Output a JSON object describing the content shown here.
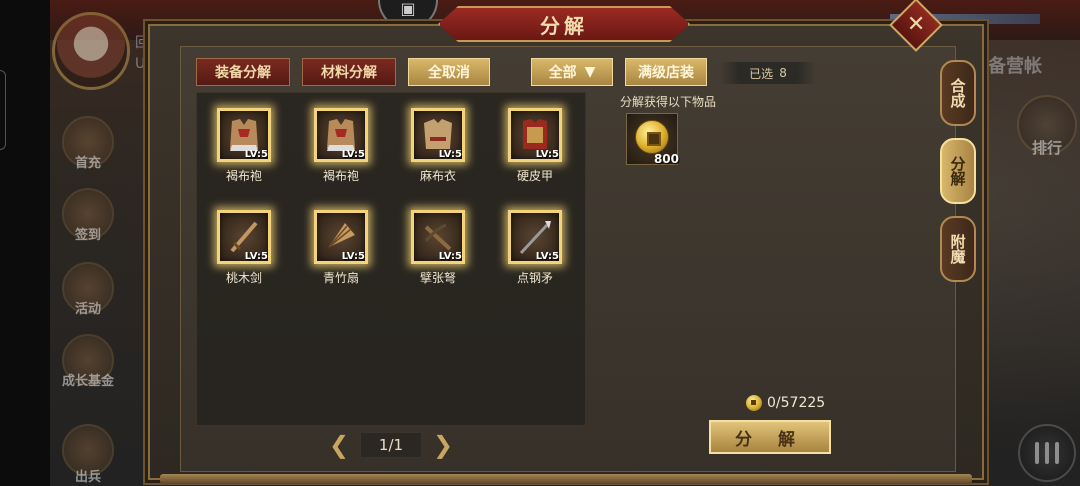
{
  "title": "分解",
  "hud": {
    "player_name": "回游",
    "uid_label": "UID",
    "side_buttons": [
      "首充",
      "签到",
      "活动",
      "成长基金",
      "出兵"
    ],
    "location": "刘备营帐",
    "rank_label": "排行"
  },
  "tabs": {
    "equip_decompose": "装备分解",
    "material_decompose": "材料分解",
    "cancel_all": "全取消",
    "filter": "全部",
    "filter_arrow": "▼",
    "full_level_equip": "满级店装",
    "selected_label": "已选",
    "selected_count": "8"
  },
  "items": [
    {
      "name": "褐布袍",
      "level": "LV:5",
      "icon": "robe-icon"
    },
    {
      "name": "褐布袍",
      "level": "LV:5",
      "icon": "robe-icon"
    },
    {
      "name": "麻布衣",
      "level": "LV:5",
      "icon": "cloth-armor-icon"
    },
    {
      "name": "硬皮甲",
      "level": "LV:5",
      "icon": "leather-armor-icon"
    },
    {
      "name": "桃木剑",
      "level": "LV:5",
      "icon": "sword-icon"
    },
    {
      "name": "青竹扇",
      "level": "LV:5",
      "icon": "fan-icon"
    },
    {
      "name": "擘张弩",
      "level": "LV:5",
      "icon": "crossbow-icon"
    },
    {
      "name": "点钢矛",
      "level": "LV:5",
      "icon": "spear-icon"
    }
  ],
  "gain": {
    "label": "分解获得以下物品",
    "item_icon": "copper-coin-icon",
    "count": "800"
  },
  "coin_total": "0/57225",
  "decompose_button": "分 解",
  "pager": {
    "prev": "❮",
    "page": "1/1",
    "next": "❯"
  },
  "side_tabs": [
    {
      "label": "合成",
      "active": false
    },
    {
      "label": "分解",
      "active": true
    },
    {
      "label": "附魔",
      "active": false
    }
  ],
  "close_icon": "✕",
  "colors": {
    "accent_red": "#7a2a20",
    "accent_gold": "#d9b86a",
    "item_glow": "#f4d47a"
  }
}
